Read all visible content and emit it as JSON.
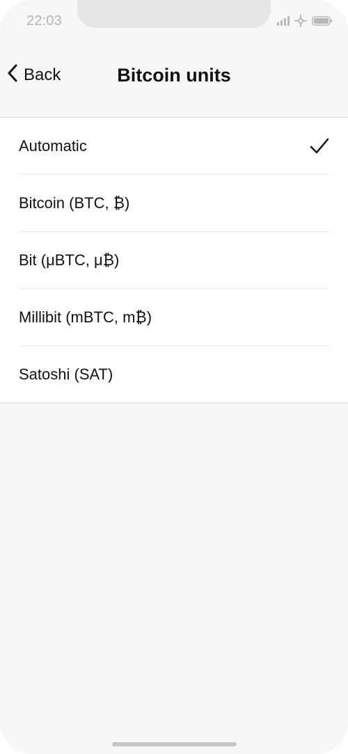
{
  "status_bar": {
    "time": "22:03",
    "icons": [
      "signal-icon",
      "wifi-icon",
      "battery-icon"
    ]
  },
  "nav": {
    "back_label": "Back",
    "title": "Bitcoin units"
  },
  "units": {
    "items": [
      {
        "label": "Automatic",
        "selected": true
      },
      {
        "label": "Bitcoin (BTC, ₿)",
        "selected": false
      },
      {
        "label": "Bit (μBTC, μ₿)",
        "selected": false
      },
      {
        "label": "Millibit (mBTC, m₿)",
        "selected": false
      },
      {
        "label": "Satoshi (SAT)",
        "selected": false
      }
    ]
  },
  "colors": {
    "background": "#f7f7f7",
    "list_background": "#ffffff",
    "text": "#111111",
    "status_gray": "#b3b3b3"
  }
}
